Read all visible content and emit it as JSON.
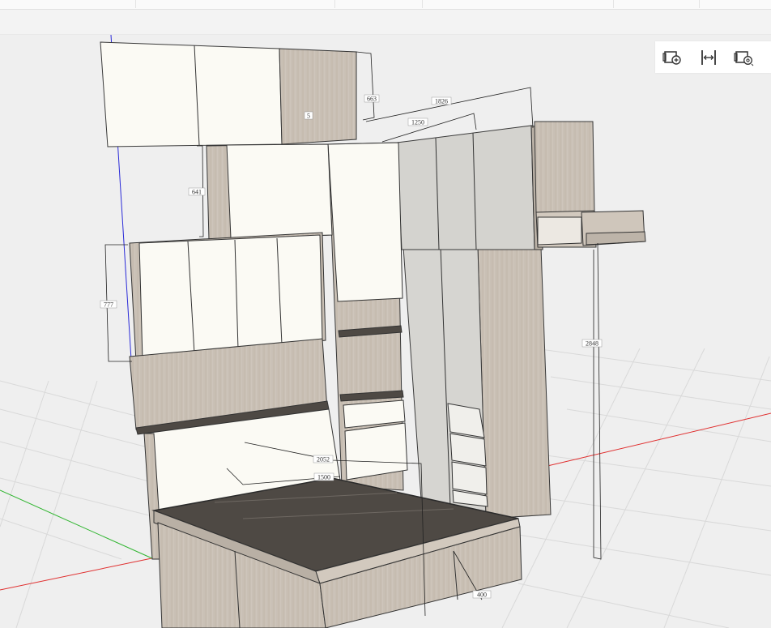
{
  "dimensions": {
    "d663": "663",
    "d1826": "1826",
    "d1250": "1250",
    "d5": "5",
    "d641": "641",
    "d777": "777",
    "d2848": "2848",
    "d2052": "2052",
    "d1500": "1500",
    "d400": "400"
  },
  "toolbar": {
    "icons": [
      "add-camera-icon",
      "measure-width-icon",
      "camera-settings-icon"
    ]
  },
  "colors": {
    "background": "#efefef",
    "grid": "#d8d8d8",
    "axis_x": "#e03030",
    "axis_y": "#2fb52f",
    "axis_z": "#2a2ad8",
    "panel_white": "#fbfaf4",
    "panel_grey": "#d4d3cf",
    "wood": "#c8bfb4",
    "wood_dark": "#a89e93",
    "bed_top": "#4e4944"
  }
}
